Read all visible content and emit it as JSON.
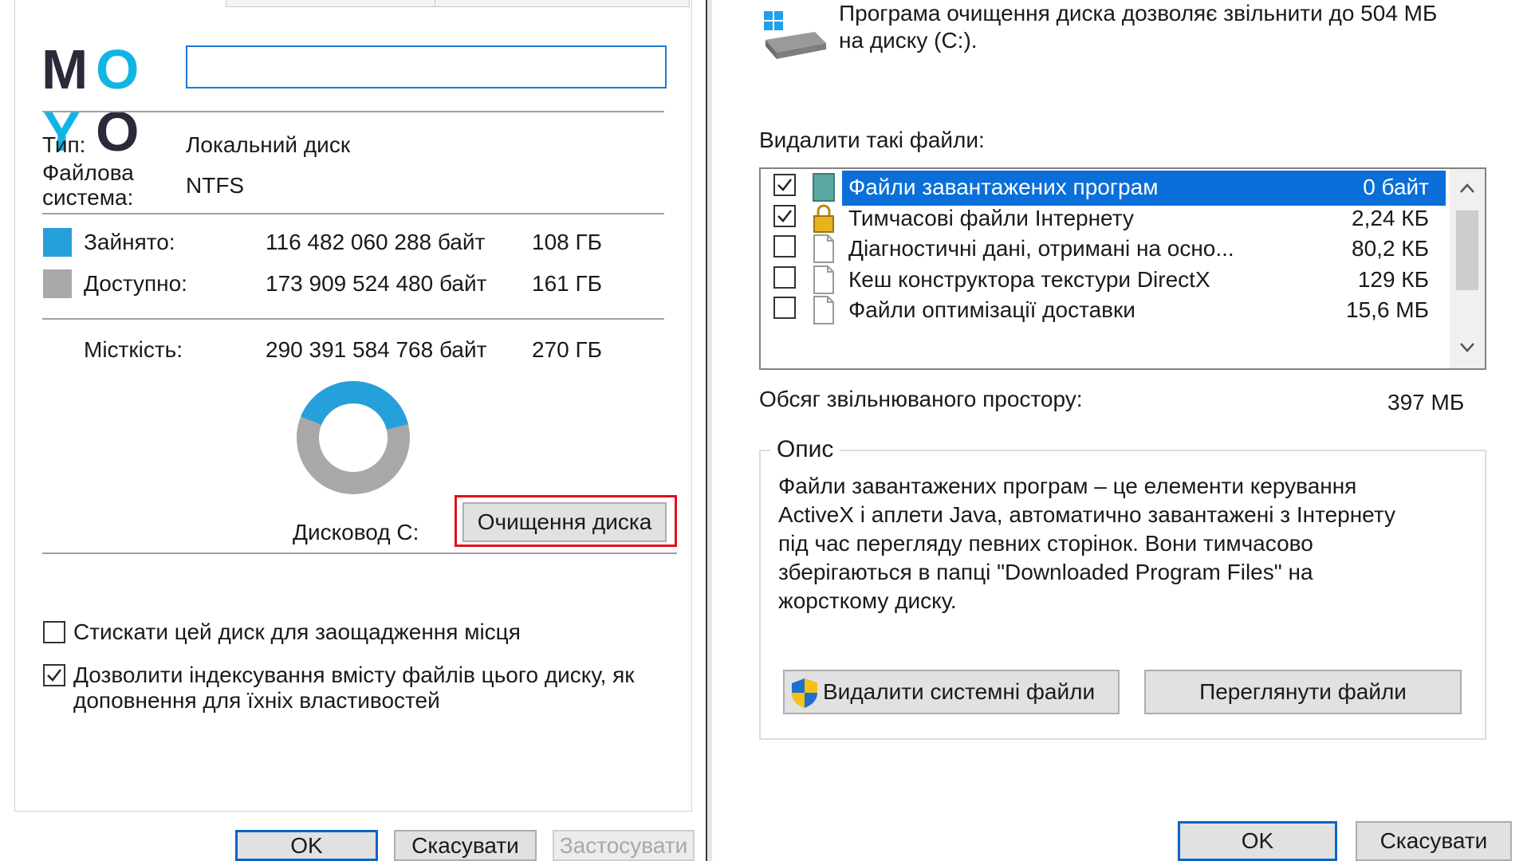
{
  "logo": {
    "letters": [
      "M",
      "O",
      "Y",
      "O"
    ]
  },
  "left": {
    "name_value": "",
    "type_label": "Тип:",
    "type_value": "Локальний диск",
    "fs_label_line1": "Файлова",
    "fs_label_line2": "система:",
    "fs_value": "NTFS",
    "used_label": "Зайнято:",
    "used_bytes": "116 482 060 288 байт",
    "used_size": "108 ГБ",
    "free_label": "Доступно:",
    "free_bytes": "173 909 524 480 байт",
    "free_size": "161 ГБ",
    "capacity_label": "Місткість:",
    "capacity_bytes": "290 391 584 768 байт",
    "capacity_size": "270 ГБ",
    "used_fraction": 0.4,
    "drive_label": "Дисковод C:",
    "cleanup_button": "Очищення диска",
    "compress_label": "Стискати цей диск для заощадження місця",
    "compress_checked": false,
    "index_label_line1": "Дозволити індексування вмісту файлів цього диску, як",
    "index_label_line2": "доповнення для їхніх властивостей",
    "index_checked": true,
    "ok": "OK",
    "cancel": "Скасувати",
    "apply": "Застосувати"
  },
  "right": {
    "header_line1": "Програма очищення диска дозволяє звільнити до 504 МБ",
    "header_line2": "на диску  (C:).",
    "files_label": "Видалити такі файли:",
    "files": [
      {
        "name": "Файли завантажених програм",
        "size": "0 байт",
        "checked": true,
        "selected": true,
        "icon": "folder-icon"
      },
      {
        "name": "Тимчасові файли Інтернету",
        "size": "2,24 КБ",
        "checked": true,
        "selected": false,
        "icon": "lock-icon"
      },
      {
        "name": "Діагностичні дані, отримані на осно...",
        "size": "80,2 КБ",
        "checked": false,
        "selected": false,
        "icon": "file-icon"
      },
      {
        "name": "Кеш конструктора текстури DirectX",
        "size": "129 КБ",
        "checked": false,
        "selected": false,
        "icon": "file-icon"
      },
      {
        "name": "Файли оптимізації доставки",
        "size": "15,6 МБ",
        "checked": false,
        "selected": false,
        "icon": "file-icon"
      }
    ],
    "freed_label": "Обсяг звільнюваного простору:",
    "freed_value": "397 МБ",
    "desc_legend": "Опис",
    "desc_text": "Файли завантажених програм – це елементи керування\nActiveX і аплети Java, автоматично завантажені з Інтернету\nпід час перегляду певних сторінок. Вони тимчасово\nзберігаються в папці \"Downloaded Program Files\" на\nжорсткому диску.",
    "sys_button": "Видалити системні файли",
    "view_button": "Переглянути файли",
    "ok": "OK",
    "cancel": "Скасувати"
  },
  "colors": {
    "used": "#26a0da",
    "free": "#a8a8a8",
    "highlight": "#e0101c",
    "selection": "#0a6fd8",
    "logo_dark": "#2b2a3a",
    "logo_cyan": "#11b5e4"
  }
}
